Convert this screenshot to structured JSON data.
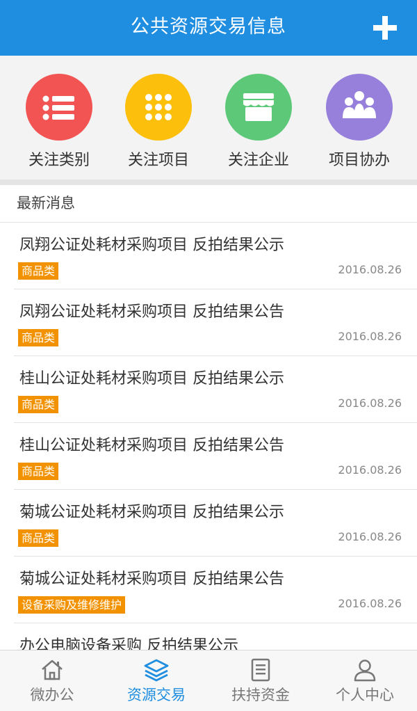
{
  "header": {
    "title": "公共资源交易信息"
  },
  "quick_actions": [
    {
      "label": "关注类别",
      "icon": "list-icon",
      "color": "#f25454"
    },
    {
      "label": "关注项目",
      "icon": "grid-dots-icon",
      "color": "#fbbf0c"
    },
    {
      "label": "关注企业",
      "icon": "storefront-icon",
      "color": "#5dc978"
    },
    {
      "label": "项目协办",
      "icon": "group-people-icon",
      "color": "#9680dc"
    }
  ],
  "news": {
    "header": "最新消息",
    "items": [
      {
        "title": "凤翔公证处耗材采购项目 反拍结果公示",
        "tag": "商品类",
        "date": "2016.08.26"
      },
      {
        "title": "凤翔公证处耗材采购项目 反拍结果公告",
        "tag": "商品类",
        "date": "2016.08.26"
      },
      {
        "title": "桂山公证处耗材采购项目 反拍结果公示",
        "tag": "商品类",
        "date": "2016.08.26"
      },
      {
        "title": "桂山公证处耗材采购项目 反拍结果公告",
        "tag": "商品类",
        "date": "2016.08.26"
      },
      {
        "title": "菊城公证处耗材采购项目 反拍结果公示",
        "tag": "商品类",
        "date": "2016.08.26"
      },
      {
        "title": "菊城公证处耗材采购项目 反拍结果公告",
        "tag": "设备采购及维修维护",
        "date": "2016.08.26"
      },
      {
        "title": "办公电脑设备采购 反拍结果公示",
        "tag": "",
        "date": ""
      }
    ]
  },
  "tabbar": [
    {
      "label": "微办公",
      "icon": "home-icon",
      "active": false
    },
    {
      "label": "资源交易",
      "icon": "layers-icon",
      "active": true
    },
    {
      "label": "扶持资金",
      "icon": "document-icon",
      "active": false
    },
    {
      "label": "个人中心",
      "icon": "person-icon",
      "active": false
    }
  ],
  "colors": {
    "primary": "#1f8ee0",
    "tag": "#f39200"
  }
}
